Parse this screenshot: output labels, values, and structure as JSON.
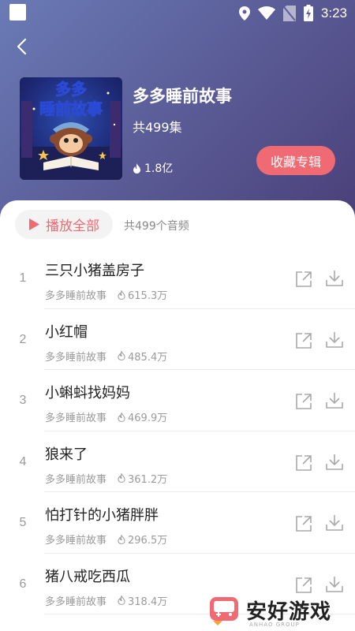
{
  "status_bar": {
    "time": "3:23",
    "icons": [
      "location-icon",
      "wifi-icon",
      "no-sim-icon",
      "battery-charging-icon"
    ]
  },
  "album": {
    "cover_title_line1": "多多",
    "cover_title_line2": "睡前故事",
    "title": "多多睡前故事",
    "episode_count": "共499集",
    "play_count": "1.8亿",
    "collect_label": "收藏专辑"
  },
  "toolbar": {
    "play_all_label": "播放全部",
    "track_total": "共499个音频"
  },
  "tracks": [
    {
      "num": "1",
      "title": "三只小猪盖房子",
      "artist": "多多睡前故事",
      "plays": "615.3万"
    },
    {
      "num": "2",
      "title": "小红帽",
      "artist": "多多睡前故事",
      "plays": "485.4万"
    },
    {
      "num": "3",
      "title": "小蝌蚪找妈妈",
      "artist": "多多睡前故事",
      "plays": "469.9万"
    },
    {
      "num": "4",
      "title": "狼来了",
      "artist": "多多睡前故事",
      "plays": "361.2万"
    },
    {
      "num": "5",
      "title": "怕打针的小猪胖胖",
      "artist": "多多睡前故事",
      "plays": "296.5万"
    },
    {
      "num": "6",
      "title": "猪八戒吃西瓜",
      "artist": "多多睡前故事",
      "plays": "318.4万"
    }
  ],
  "watermark": {
    "text": "安好游戏",
    "sub": "ANHAO GROUP"
  },
  "colors": {
    "accent": "#f06a74",
    "header_start": "#6a7bb5",
    "header_end": "#4a3f78"
  }
}
